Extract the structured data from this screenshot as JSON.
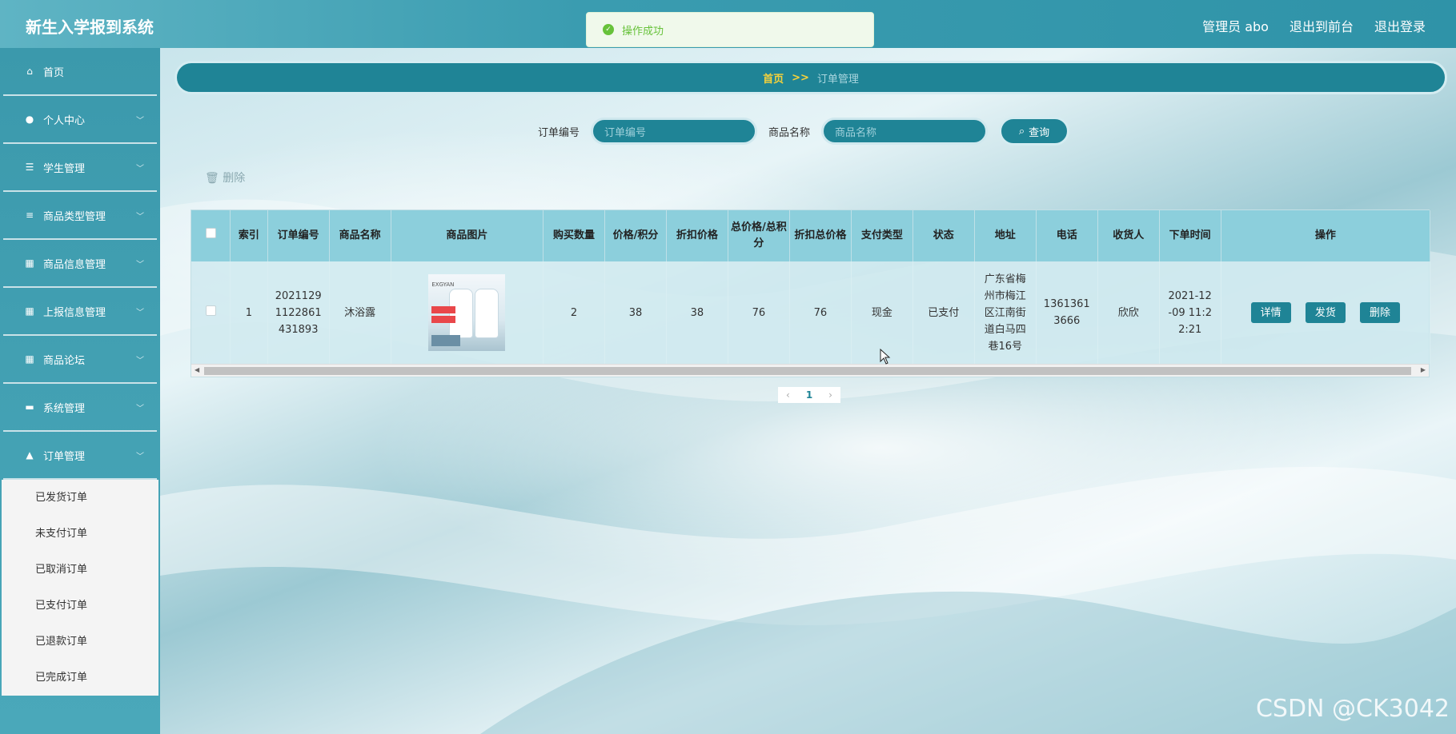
{
  "app": {
    "title": "新生入学报到系统"
  },
  "header": {
    "user": "管理员 abo",
    "to_front": "退出到前台",
    "logout": "退出登录"
  },
  "toast": {
    "message": "操作成功"
  },
  "sidebar": {
    "items": [
      {
        "label": "首页",
        "icon": "home-icon"
      },
      {
        "label": "个人中心",
        "icon": "user-icon"
      },
      {
        "label": "学生管理",
        "icon": "sliders-icon"
      },
      {
        "label": "商品类型管理",
        "icon": "list-icon"
      },
      {
        "label": "商品信息管理",
        "icon": "grid-icon"
      },
      {
        "label": "上报信息管理",
        "icon": "grid-icon"
      },
      {
        "label": "商品论坛",
        "icon": "grid-icon"
      },
      {
        "label": "系统管理",
        "icon": "briefcase-icon"
      },
      {
        "label": "订单管理",
        "icon": "thumb-icon"
      }
    ],
    "order_submenu": [
      "已发货订单",
      "未支付订单",
      "已取消订单",
      "已支付订单",
      "已退款订单",
      "已完成订单"
    ]
  },
  "breadcrumb": {
    "home": "首页",
    "sep": ">>",
    "current": "订单管理"
  },
  "search": {
    "order_label": "订单编号",
    "order_placeholder": "订单编号",
    "name_label": "商品名称",
    "name_placeholder": "商品名称",
    "button": "查询"
  },
  "batch_delete": "删除",
  "table": {
    "headers": [
      "索引",
      "订单编号",
      "商品名称",
      "商品图片",
      "购买数量",
      "价格/积分",
      "折扣价格",
      "总价格/总积分",
      "折扣总价格",
      "支付类型",
      "状态",
      "地址",
      "电话",
      "收货人",
      "下单时间",
      "操作"
    ],
    "rows": [
      {
        "index": "1",
        "order_no": "2021129 1122861 431893",
        "name": "沐浴露",
        "image_brand": "EXGYAN",
        "quantity": "2",
        "price": "38",
        "discount_price": "38",
        "total": "76",
        "discount_total": "76",
        "pay_type": "现金",
        "status": "已支付",
        "address": "广东省梅州市梅江区江南街道白马四巷16号",
        "phone": "1361361 3666",
        "receiver": "欣欣",
        "time": "2021-12 -09 11:2 2:21",
        "actions": {
          "detail": "详情",
          "ship": "发货",
          "delete": "删除"
        }
      }
    ]
  },
  "pagination": {
    "current": "1",
    "prev": "‹",
    "next": "›"
  },
  "watermark": "CSDN @CK3042"
}
